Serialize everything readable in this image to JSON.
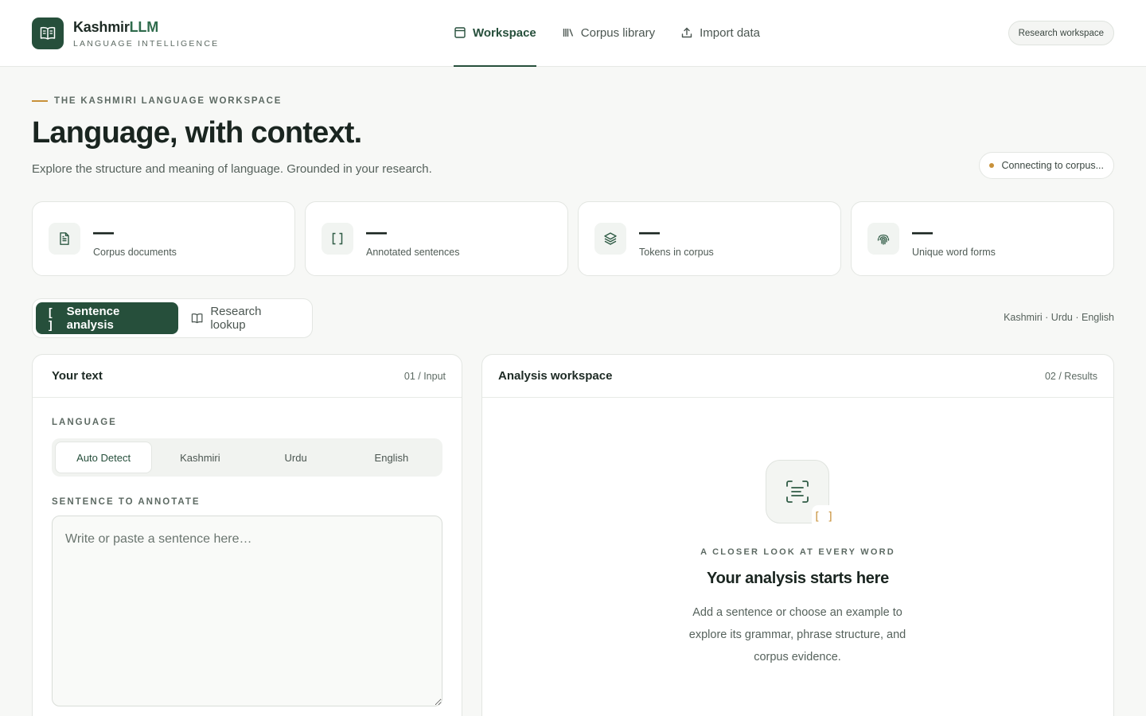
{
  "brand": {
    "name_main": "Kashmir",
    "name_accent": "LLM",
    "tagline": "LANGUAGE INTELLIGENCE",
    "logo_icon": "open-book-icon"
  },
  "nav": {
    "items": [
      {
        "label": "Workspace",
        "icon": "layout-icon",
        "active": true
      },
      {
        "label": "Corpus library",
        "icon": "library-icon",
        "active": false
      },
      {
        "label": "Import data",
        "icon": "upload-icon",
        "active": false
      }
    ],
    "workspace_button": "Research workspace"
  },
  "hero": {
    "eyebrow": "THE KASHMIRI LANGUAGE WORKSPACE",
    "title": "Language, with context.",
    "subtitle": "Explore the structure and meaning of language. Grounded in your research.",
    "status": "Connecting to corpus..."
  },
  "stats": [
    {
      "value": "—",
      "label": "Corpus documents",
      "icon": "document-icon"
    },
    {
      "value": "—",
      "label": "Annotated sentences",
      "icon": "brackets-icon"
    },
    {
      "value": "—",
      "label": "Tokens in corpus",
      "icon": "layers-icon"
    },
    {
      "value": "—",
      "label": "Unique word forms",
      "icon": "fingerprint-icon"
    }
  ],
  "tabs": {
    "items": [
      {
        "label": "Sentence analysis",
        "glyph": "[ ]",
        "active": true
      },
      {
        "label": "Research lookup",
        "glyph": "book",
        "active": false
      }
    ],
    "languages_note": "Kashmiri · Urdu · English"
  },
  "input_panel": {
    "title": "Your text",
    "step": "01 / Input",
    "language_label": "LANGUAGE",
    "language_options": [
      "Auto Detect",
      "Kashmiri",
      "Urdu",
      "English"
    ],
    "selected_language": "Auto Detect",
    "sentence_label": "SENTENCE TO ANNOTATE",
    "sentence_placeholder": "Write or paste a sentence here…",
    "sentence_value": ""
  },
  "results_panel": {
    "title": "Analysis workspace",
    "step": "02 / Results",
    "empty_badge": "[ ]",
    "empty_eyebrow": "A CLOSER LOOK AT EVERY WORD",
    "empty_title": "Your analysis starts here",
    "empty_description": "Add a sentence or choose an example to explore its grammar, phrase structure, and corpus evidence."
  },
  "colors": {
    "brand_green": "#264f3b",
    "accent_amber": "#c8913a",
    "background": "#f7f8f6"
  }
}
